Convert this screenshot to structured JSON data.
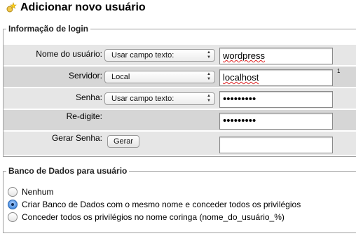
{
  "page": {
    "title": "Adicionar novo usuário",
    "title_icon": "add-user-star-icon"
  },
  "login": {
    "legend": "Informação de login",
    "username": {
      "label": "Nome do usuário:",
      "select": "Usar campo texto:",
      "value": "wordpress"
    },
    "server": {
      "label": "Servidor:",
      "select": "Local",
      "value": "localhost",
      "footnote": "1"
    },
    "password": {
      "label": "Senha:",
      "select": "Usar campo texto:",
      "value": "•••••••••"
    },
    "retype": {
      "label": "Re-digite:",
      "value": "•••••••••"
    },
    "generate": {
      "label": "Gerar Senha:",
      "button": "Gerar",
      "value": ""
    }
  },
  "database": {
    "legend": "Banco de Dados para usuário",
    "options": [
      {
        "label": "Nenhum",
        "checked": false
      },
      {
        "label": "Criar Banco de Dados com o mesmo nome e conceder todos os privilégios",
        "checked": true
      },
      {
        "label": "Conceder todos os privilégios no nome coringa (nome_do_usuário_%)",
        "checked": false
      }
    ]
  },
  "colors": {
    "row_odd": "#e6e6e6",
    "row_even": "#d6d6d6",
    "radio_selected": "#4a8ee0"
  }
}
